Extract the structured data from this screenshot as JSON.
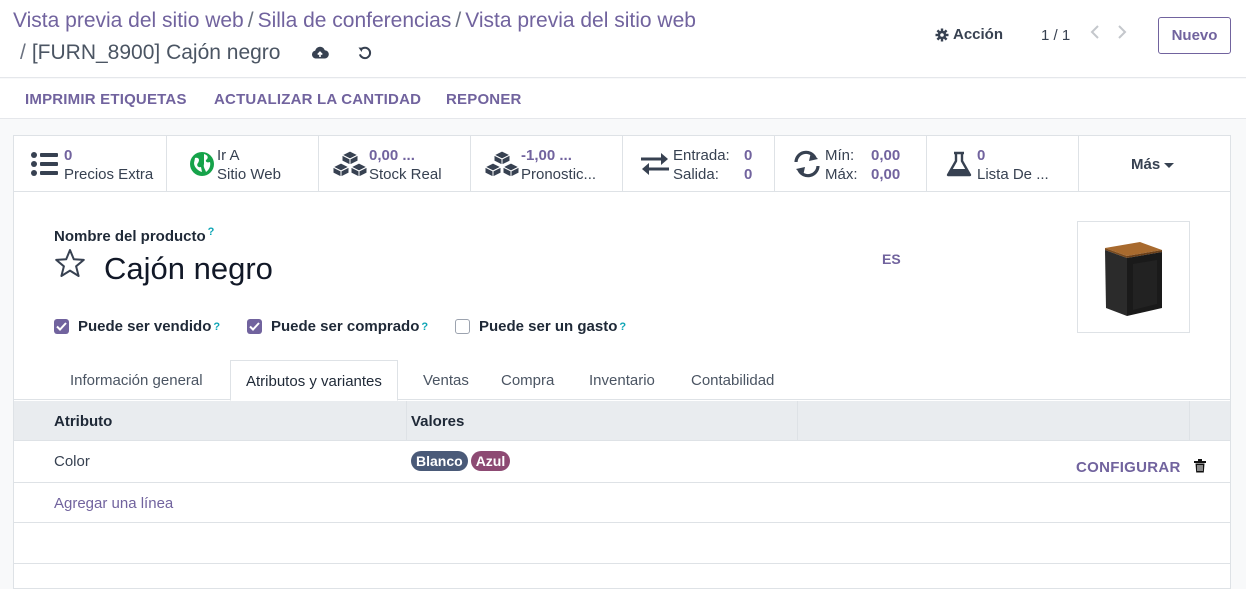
{
  "breadcrumb": {
    "items": [
      "Vista previa del sitio web",
      "Silla de conferencias",
      "Vista previa del sitio web"
    ],
    "current": "[FURN_8900] Cajón negro",
    "separator": "/"
  },
  "control": {
    "action_label": "Acción",
    "pager": "1 / 1",
    "new_label": "Nuevo"
  },
  "actions": {
    "print": "IMPRIMIR ETIQUETAS",
    "update_qty": "ACTUALIZAR LA CANTIDAD",
    "replenish": "REPONER"
  },
  "stats": {
    "extra_prices": {
      "value": "0",
      "label": "Precios Extra"
    },
    "website": {
      "line1": "Ir A",
      "line2": "Sitio Web"
    },
    "real_stock": {
      "value": "0,00 ...",
      "label": "Stock Real"
    },
    "forecast": {
      "value": "-1,00 ...",
      "label": "Pronostic..."
    },
    "in_out": {
      "in_label": "Entrada:",
      "in_value": "0",
      "out_label": "Salida:",
      "out_value": "0"
    },
    "min_max": {
      "min_label": "Mín:",
      "min_value": "0,00",
      "max_label": "Máx:",
      "max_value": "0,00"
    },
    "bom": {
      "value": "0",
      "label": "Lista De ..."
    },
    "more": "Más"
  },
  "product": {
    "name_label": "Nombre del producto",
    "help": "?",
    "name": "Cajón negro",
    "lang": "ES",
    "can_sell": {
      "label": "Puede ser vendido",
      "checked": true
    },
    "can_buy": {
      "label": "Puede ser comprado",
      "checked": true
    },
    "can_expense": {
      "label": "Puede ser un gasto",
      "checked": false
    }
  },
  "tabs": [
    "Información general",
    "Atributos y variantes",
    "Ventas",
    "Compra",
    "Inventario",
    "Contabilidad"
  ],
  "active_tab": "Atributos y variantes",
  "table": {
    "headers": [
      "Atributo",
      "Valores"
    ],
    "rows": [
      {
        "attribute": "Color",
        "values": [
          {
            "label": "Blanco",
            "color": "#4a5a78"
          },
          {
            "label": "Azul",
            "color": "#8d4a73"
          }
        ],
        "action": "CONFIGURAR"
      }
    ],
    "add_line": "Agregar una línea"
  },
  "colors": {
    "accent": "#71639e",
    "help": "#0ea5b5"
  },
  "icons": [
    "cloud-upload-icon",
    "undo-icon",
    "gear-icon",
    "chevron-left-icon",
    "chevron-right-icon",
    "list-icon",
    "globe-icon",
    "cubes-icon",
    "exchange-icon",
    "refresh-icon",
    "flask-icon",
    "caret-down-icon",
    "star-icon",
    "trash-icon"
  ]
}
